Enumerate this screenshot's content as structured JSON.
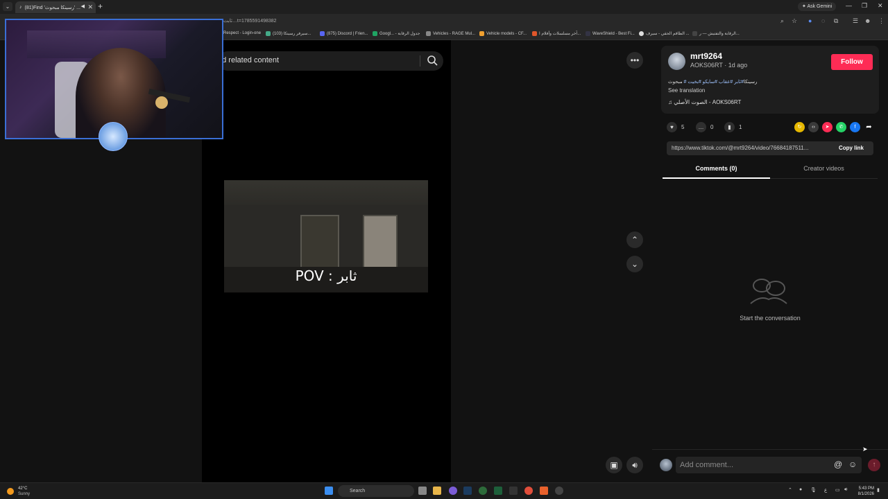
{
  "browser": {
    "tab_title": "(81)Find 'رسينكا مبحوث' ...",
    "ask_gemini": "Ask Gemini",
    "url": "ثابت…t=1785591498382",
    "bookmarks": [
      "Respect - Login-one",
      "(103) سيرفر رسينكا...",
      "(875) Discord | Frien...",
      "Googl... - جدول الرقابة",
      "Vehicles - RAGE Mul...",
      "Vehicle models - CF...",
      "آخر مسلسلات وأفلام ا...",
      "WaveShield - Best Fi...",
      "الطاقم الحقي - سيرف ...",
      "الرقابة والتفتيش — ر..."
    ]
  },
  "search": {
    "placeholder": "nd related content"
  },
  "video": {
    "overlay_text": "POV : ثابر"
  },
  "author": {
    "username": "mrt9264",
    "subline": "AOKS06RT · 1d ago",
    "follow_label": "Follow",
    "caption_prefix": "رسينكا",
    "caption_tags": "#ثابر #عقاب #سايكو #بخيت #",
    "caption_suffix": " مبحوث",
    "see_translation": "See translation",
    "music": "الصوت الأصلي - AOKS06RT"
  },
  "actions": {
    "likes": "5",
    "comments": "0",
    "saves": "1"
  },
  "link": {
    "url": "https://www.tiktok.com/@mrt9264/video/76684187511...",
    "copy_label": "Copy link"
  },
  "tabs": {
    "comments": "Comments (0)",
    "creator_videos": "Creator videos"
  },
  "empty_state": {
    "text": "Start the conversation"
  },
  "comment": {
    "placeholder": "Add comment..."
  },
  "taskbar": {
    "temp": "42°C",
    "condition": "Sunny",
    "search_label": "Search",
    "time": "5:43 PM",
    "date": "8/1/2026"
  },
  "colors": {
    "follow": "#fe2c55",
    "webcam_border": "#3a6fd6",
    "background": "#121212"
  }
}
